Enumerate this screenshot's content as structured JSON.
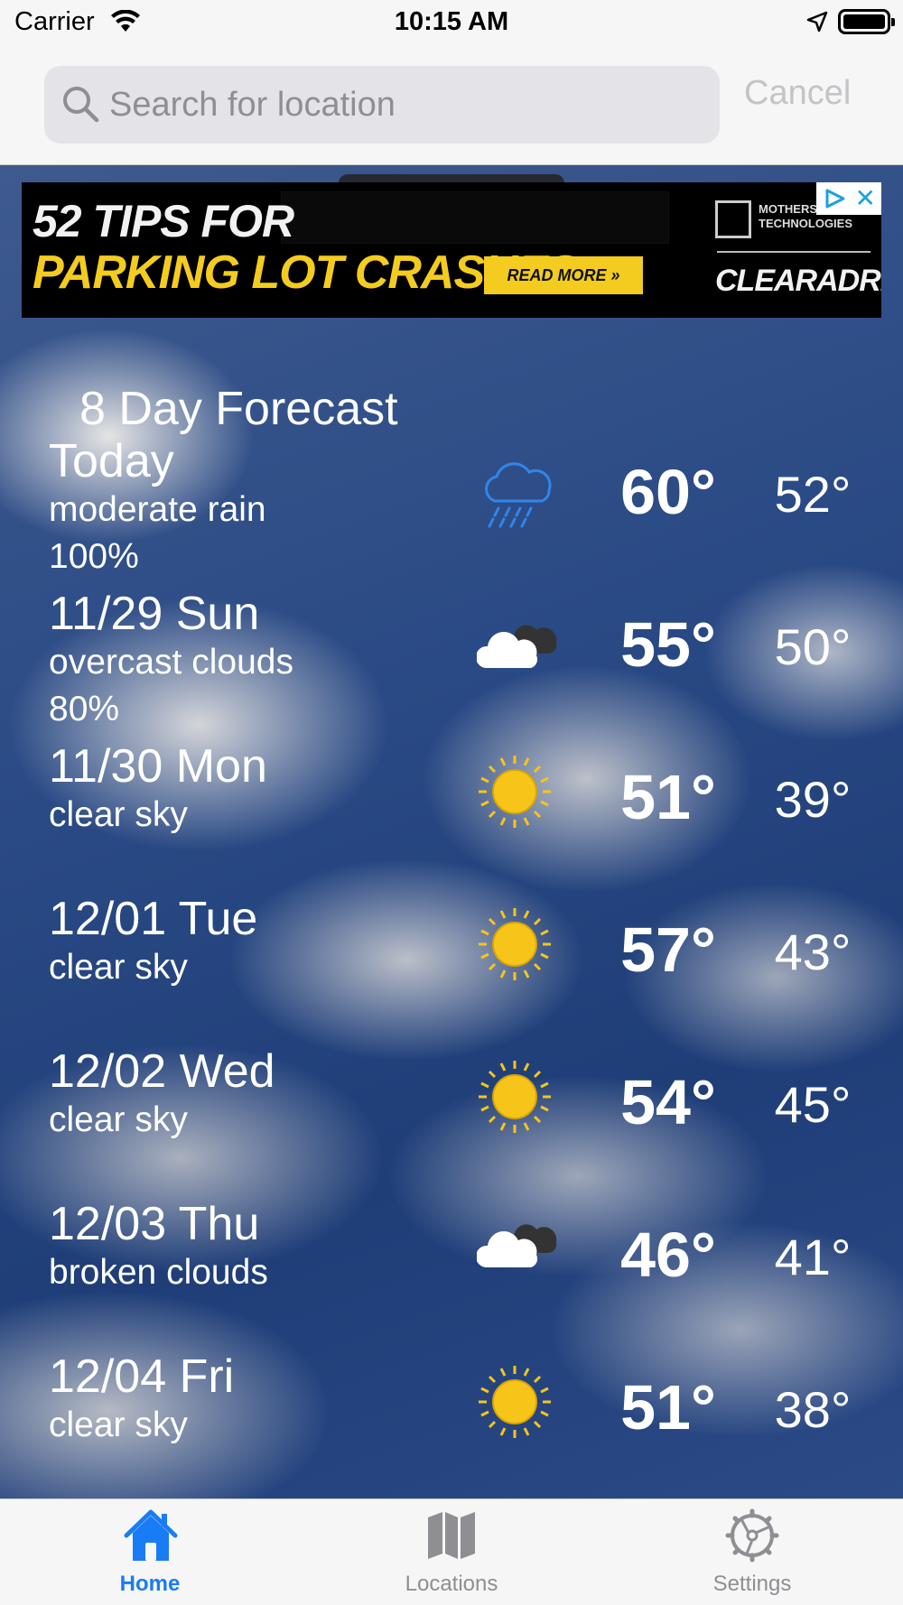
{
  "status_bar": {
    "carrier": "Carrier",
    "time": "10:15 AM"
  },
  "search": {
    "placeholder": "Search for location",
    "cancel_label": "Cancel"
  },
  "ad": {
    "line1": "52 TIPS FOR",
    "line2": "PARKING LOT CRASHES",
    "read_more": "READ MORE »",
    "logo_text": "MOTHERS TECHNOLOGIES",
    "brand": "CLEARADRIVE",
    "close": "✕"
  },
  "forecast": {
    "title": "8 Day Forecast",
    "days": [
      {
        "day": "Today",
        "desc": "moderate rain",
        "precip": "100%",
        "icon": "rain-cloud-icon",
        "hi": "60°",
        "lo": "52°"
      },
      {
        "day": "11/29 Sun",
        "desc": "overcast clouds",
        "precip": "80%",
        "icon": "cloudy-icon",
        "hi": "55°",
        "lo": "50°"
      },
      {
        "day": "11/30 Mon",
        "desc": "clear sky",
        "precip": "",
        "icon": "sun-icon",
        "hi": "51°",
        "lo": "39°"
      },
      {
        "day": "12/01 Tue",
        "desc": "clear sky",
        "precip": "",
        "icon": "sun-icon",
        "hi": "57°",
        "lo": "43°"
      },
      {
        "day": "12/02 Wed",
        "desc": "clear sky",
        "precip": "",
        "icon": "sun-icon",
        "hi": "54°",
        "lo": "45°"
      },
      {
        "day": "12/03 Thu",
        "desc": "broken clouds",
        "precip": "",
        "icon": "cloudy-icon",
        "hi": "46°",
        "lo": "41°"
      },
      {
        "day": "12/04 Fri",
        "desc": "clear sky",
        "precip": "",
        "icon": "sun-icon",
        "hi": "51°",
        "lo": "38°"
      }
    ]
  },
  "tabs": [
    {
      "label": "Home",
      "icon": "home-icon",
      "active": true
    },
    {
      "label": "Locations",
      "icon": "map-icon",
      "active": false
    },
    {
      "label": "Settings",
      "icon": "gear-icon",
      "active": false
    }
  ],
  "colors": {
    "accent": "#1a7cf5",
    "ad_yellow": "#f3cc1f",
    "sun": "#f7c51a",
    "rain": "#2f86ec"
  }
}
